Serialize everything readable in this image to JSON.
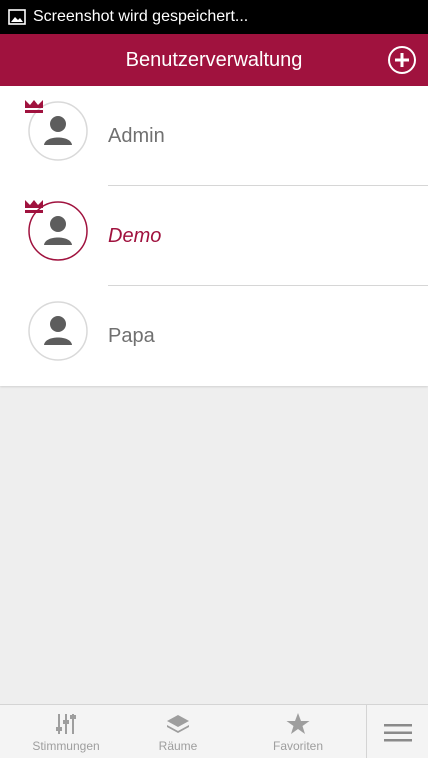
{
  "statusbar": {
    "text": "Screenshot wird gespeichert...",
    "icon": "image-icon"
  },
  "appbar": {
    "title": "Benutzerverwaltung",
    "add_icon": "plus-circle-icon"
  },
  "users": [
    {
      "name": "Admin",
      "admin": true,
      "selected": false
    },
    {
      "name": "Demo",
      "admin": true,
      "selected": true
    },
    {
      "name": "Papa",
      "admin": false,
      "selected": false
    }
  ],
  "tabs": [
    {
      "label": "Stimmungen",
      "icon": "sliders-icon"
    },
    {
      "label": "Räume",
      "icon": "layers-icon"
    },
    {
      "label": "Favoriten",
      "icon": "star-icon"
    }
  ],
  "menu_icon": "hamburger-menu-icon",
  "colors": {
    "accent": "#a0123e",
    "background": "#eeeeee",
    "text": "#707070"
  }
}
